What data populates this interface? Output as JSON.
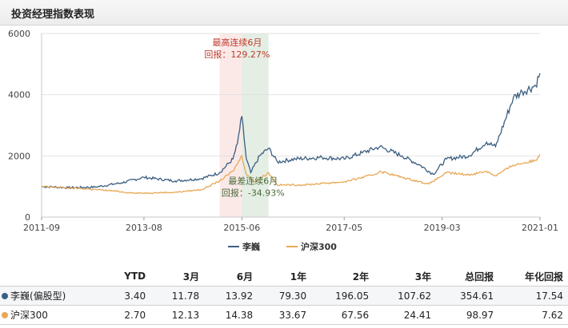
{
  "header": {
    "title": "投资经理指数表现"
  },
  "chart_data": {
    "type": "line",
    "ylim": [
      0,
      6000
    ],
    "yticks": [
      0,
      2000,
      4000,
      6000
    ],
    "x_range": [
      "2011-09",
      "2021-01"
    ],
    "xtick_labels": [
      "2011-09",
      "2013-08",
      "2015-06",
      "2017-05",
      "2019-03",
      "2021-01"
    ],
    "grid": true,
    "legend_position": "bottom-center",
    "series": [
      {
        "name": "李巍",
        "color": "#3b5f82",
        "points": [
          [
            "2011-09",
            1000
          ],
          [
            "2012-03",
            960
          ],
          [
            "2012-09",
            980
          ],
          [
            "2013-03",
            1120
          ],
          [
            "2013-08",
            1300
          ],
          [
            "2014-03",
            1180
          ],
          [
            "2014-09",
            1260
          ],
          [
            "2015-01",
            1450
          ],
          [
            "2015-04",
            1900
          ],
          [
            "2015-05",
            2400
          ],
          [
            "2015-06",
            3300
          ],
          [
            "2015-07",
            1900
          ],
          [
            "2015-08",
            1450
          ],
          [
            "2015-10",
            2000
          ],
          [
            "2015-12",
            2250
          ],
          [
            "2016-02",
            1800
          ],
          [
            "2016-06",
            1900
          ],
          [
            "2016-12",
            1950
          ],
          [
            "2017-05",
            1900
          ],
          [
            "2017-09",
            2100
          ],
          [
            "2018-01",
            2300
          ],
          [
            "2018-06",
            2000
          ],
          [
            "2018-10",
            1700
          ],
          [
            "2019-01",
            1400
          ],
          [
            "2019-04",
            1900
          ],
          [
            "2019-09",
            2000
          ],
          [
            "2020-01",
            2450
          ],
          [
            "2020-03",
            2300
          ],
          [
            "2020-07",
            3900
          ],
          [
            "2020-09",
            4100
          ],
          [
            "2020-12",
            4300
          ],
          [
            "2021-01",
            4700
          ]
        ]
      },
      {
        "name": "沪深300",
        "color": "#e8a856",
        "points": [
          [
            "2011-09",
            1000
          ],
          [
            "2012-06",
            930
          ],
          [
            "2012-12",
            870
          ],
          [
            "2013-06",
            780
          ],
          [
            "2014-03",
            810
          ],
          [
            "2014-09",
            900
          ],
          [
            "2015-01",
            1180
          ],
          [
            "2015-04",
            1500
          ],
          [
            "2015-06",
            2000
          ],
          [
            "2015-07",
            1400
          ],
          [
            "2015-09",
            1150
          ],
          [
            "2015-12",
            1450
          ],
          [
            "2016-02",
            1050
          ],
          [
            "2016-08",
            1050
          ],
          [
            "2016-12",
            1100
          ],
          [
            "2017-05",
            1150
          ],
          [
            "2017-12",
            1400
          ],
          [
            "2018-01",
            1500
          ],
          [
            "2018-06",
            1300
          ],
          [
            "2018-12",
            1080
          ],
          [
            "2019-04",
            1450
          ],
          [
            "2019-09",
            1380
          ],
          [
            "2020-01",
            1500
          ],
          [
            "2020-03",
            1350
          ],
          [
            "2020-07",
            1700
          ],
          [
            "2020-12",
            1850
          ],
          [
            "2021-01",
            2050
          ]
        ]
      }
    ],
    "annotations": [
      {
        "label": "最高连续6月",
        "value_label": "回报：129.27%",
        "from": "2015-01",
        "to": "2015-06",
        "color": "#c0392b"
      },
      {
        "label": "最差连续6月",
        "value_label": "回报：-34.93%",
        "from": "2015-06",
        "to": "2015-12",
        "color": "#4a6a3a"
      }
    ]
  },
  "table": {
    "headers": [
      "YTD",
      "3月",
      "6月",
      "1年",
      "2年",
      "3年",
      "总回报",
      "年化回报"
    ],
    "rows": [
      {
        "name": "李巍(偏股型)",
        "dot_color": "#3b5f82",
        "values": [
          "3.40",
          "11.78",
          "13.92",
          "79.30",
          "196.05",
          "107.62",
          "354.61",
          "17.54"
        ]
      },
      {
        "name": "沪深300",
        "dot_color": "#e8a856",
        "values": [
          "2.70",
          "12.13",
          "14.38",
          "33.67",
          "67.56",
          "24.41",
          "98.97",
          "7.62"
        ]
      }
    ]
  }
}
